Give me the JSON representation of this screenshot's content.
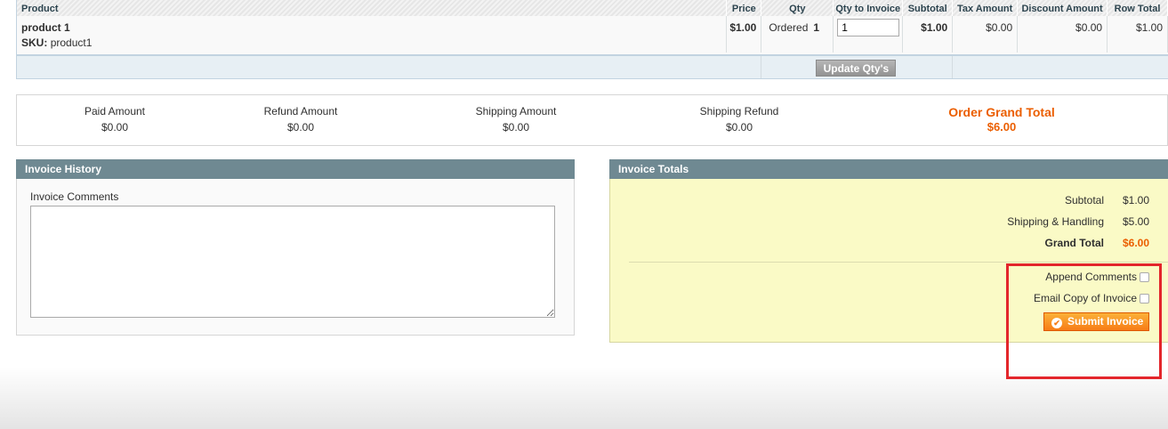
{
  "items_grid": {
    "columns": [
      "Product",
      "Price",
      "Qty",
      "Qty to Invoice",
      "Subtotal",
      "Tax Amount",
      "Discount Amount",
      "Row Total"
    ],
    "item": {
      "name": "product 1",
      "sku_label": "SKU:",
      "sku_value": "product1",
      "price": "$1.00",
      "qty_status": "Ordered",
      "qty_value": "1",
      "qty_to_invoice": "1",
      "subtotal": "$1.00",
      "tax_amount": "$0.00",
      "discount_amount": "$0.00",
      "row_total": "$1.00"
    },
    "update_button": "Update Qty's"
  },
  "order_totals": {
    "paid_amount_label": "Paid Amount",
    "paid_amount": "$0.00",
    "refund_amount_label": "Refund Amount",
    "refund_amount": "$0.00",
    "shipping_amount_label": "Shipping Amount",
    "shipping_amount": "$0.00",
    "shipping_refund_label": "Shipping Refund",
    "shipping_refund": "$0.00",
    "grand_total_label": "Order Grand Total",
    "grand_total": "$6.00"
  },
  "invoice_history": {
    "title": "Invoice History",
    "comments_label": "Invoice Comments",
    "comments_value": ""
  },
  "invoice_totals": {
    "title": "Invoice Totals",
    "subtotal_label": "Subtotal",
    "subtotal": "$1.00",
    "shipping_label": "Shipping & Handling",
    "shipping": "$5.00",
    "grand_total_label": "Grand Total",
    "grand_total": "$6.00",
    "append_comments_label": "Append Comments",
    "email_copy_label": "Email Copy of Invoice",
    "submit_label": "Submit Invoice"
  },
  "colors": {
    "accent": "#eb5e00",
    "box_header": "#6f8992",
    "totals_background": "#fafac6",
    "highlight": "#e3262b"
  }
}
